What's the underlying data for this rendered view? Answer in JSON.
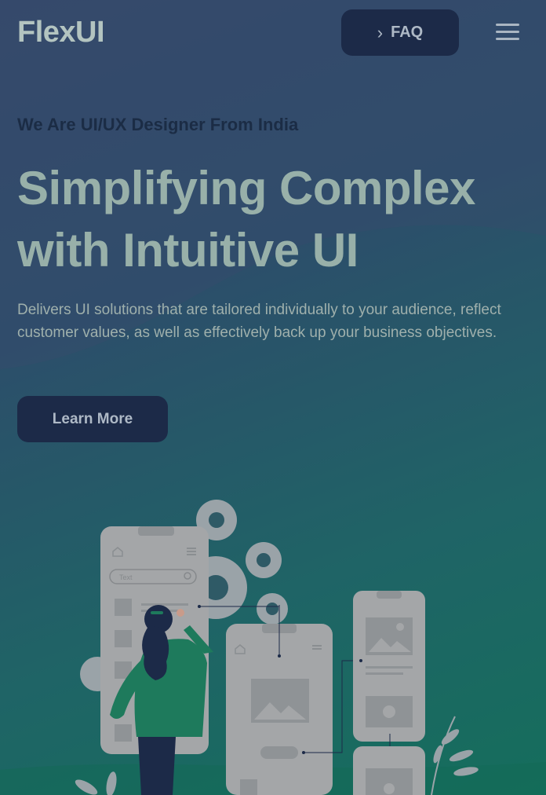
{
  "header": {
    "logo": "FlexUI",
    "faq_label": "FAQ"
  },
  "hero": {
    "tagline": "We Are UI/UX Designer From India",
    "title_line1": "Simplifying Complex",
    "title_line2": "with Intuitive UI",
    "description": "Delivers UI solutions that are tailored individually to your audience, reflect customer values, as well as effectively back up your business objectives.",
    "cta_label": "Learn More"
  },
  "illustration": {
    "search_placeholder": "Text"
  },
  "colors": {
    "button_bg": "#1c2a48",
    "accent_green": "#1e7a5c",
    "heading": "#98b0a9"
  }
}
